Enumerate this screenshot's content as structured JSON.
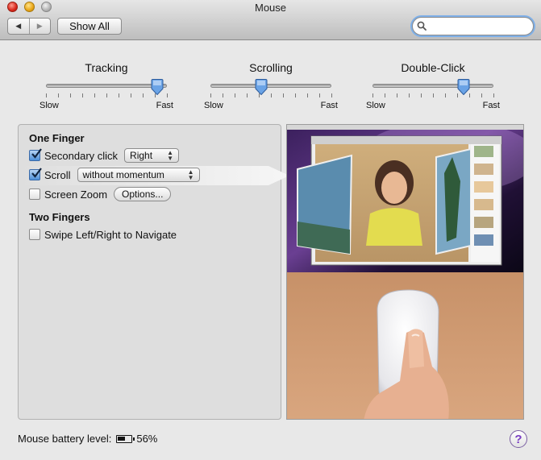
{
  "window": {
    "title": "Mouse"
  },
  "toolbar": {
    "back_glyph": "◀",
    "forward_glyph": "▶",
    "show_all_label": "Show All"
  },
  "search": {
    "placeholder": "",
    "value": ""
  },
  "sliders": [
    {
      "id": "tracking",
      "label": "Tracking",
      "min_label": "Slow",
      "max_label": "Fast",
      "level": 0.92
    },
    {
      "id": "scrolling",
      "label": "Scrolling",
      "min_label": "Slow",
      "max_label": "Fast",
      "level": 0.42
    },
    {
      "id": "double-click",
      "label": "Double-Click",
      "min_label": "Slow",
      "max_label": "Fast",
      "level": 0.75
    }
  ],
  "one_finger": {
    "heading": "One Finger",
    "secondary_click": {
      "label": "Secondary click",
      "checked": true,
      "option": "Right"
    },
    "scroll": {
      "label": "Scroll",
      "checked": true,
      "option": "without momentum"
    },
    "screen_zoom": {
      "label": "Screen Zoom",
      "checked": false,
      "options_button": "Options..."
    }
  },
  "two_fingers": {
    "heading": "Two Fingers",
    "swipe": {
      "label": "Swipe Left/Right to Navigate",
      "checked": false
    }
  },
  "footer": {
    "battery_label": "Mouse battery level:",
    "battery_value": "56%",
    "battery_level": 0.56,
    "help_glyph": "?"
  },
  "colors": {
    "accent": "#4d8fd8",
    "help": "#7a3dc4"
  }
}
